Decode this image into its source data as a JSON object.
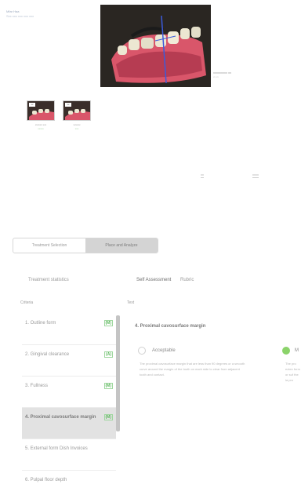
{
  "header": {
    "link_line1": "Mfar Haa",
    "link_line2": "Sxx xxx xxx xxx xxx"
  },
  "viewer": {
    "side_label": "xxxxxxxxx xx",
    "side_label2": "xx xx"
  },
  "thumbnails": [
    {
      "badge": "xx",
      "caption": "xxxxxx xxx",
      "caption2": "xxxxx"
    },
    {
      "badge": "xx",
      "caption": "xxxxxx",
      "caption2": "xxx"
    }
  ],
  "tiny_buttons": [
    "xx",
    "xxxx"
  ],
  "segment": {
    "option1": "Treatment Selection",
    "option2": "Place and Analyze"
  },
  "tabs": {
    "tab1": "Treatment statistics",
    "tab2": "Self Assessment",
    "tab3": "Rubric"
  },
  "columns": {
    "criteria": "Criteria",
    "text": "Text"
  },
  "criteria": [
    {
      "name": "1. Outline form",
      "grade": "(M)"
    },
    {
      "name": "2. Gingival clearance",
      "grade": "(A)"
    },
    {
      "name": "3. Fullness",
      "grade": "(M)"
    },
    {
      "name": "4. Proximal cavosurface margin",
      "grade": "(M)"
    },
    {
      "name": "5. External form Dish Invoices",
      "grade": ""
    },
    {
      "name": "6. Pulpal floor depth",
      "grade": ""
    }
  ],
  "detail": {
    "title": "4. Proximal cavosurface margin",
    "option_acceptable": "Acceptable",
    "option_other": "M",
    "desc_left": "The proximal cavosurface margin that are less than 90 degrees or a smooth curve around the margin of the tooth on each side to clear from adjacent tooth and contact.",
    "desc_right": "The pro exten form or suf the la pro"
  },
  "colors": {
    "accent_green": "#8bd36a",
    "grade_green": "#5cb85c"
  }
}
